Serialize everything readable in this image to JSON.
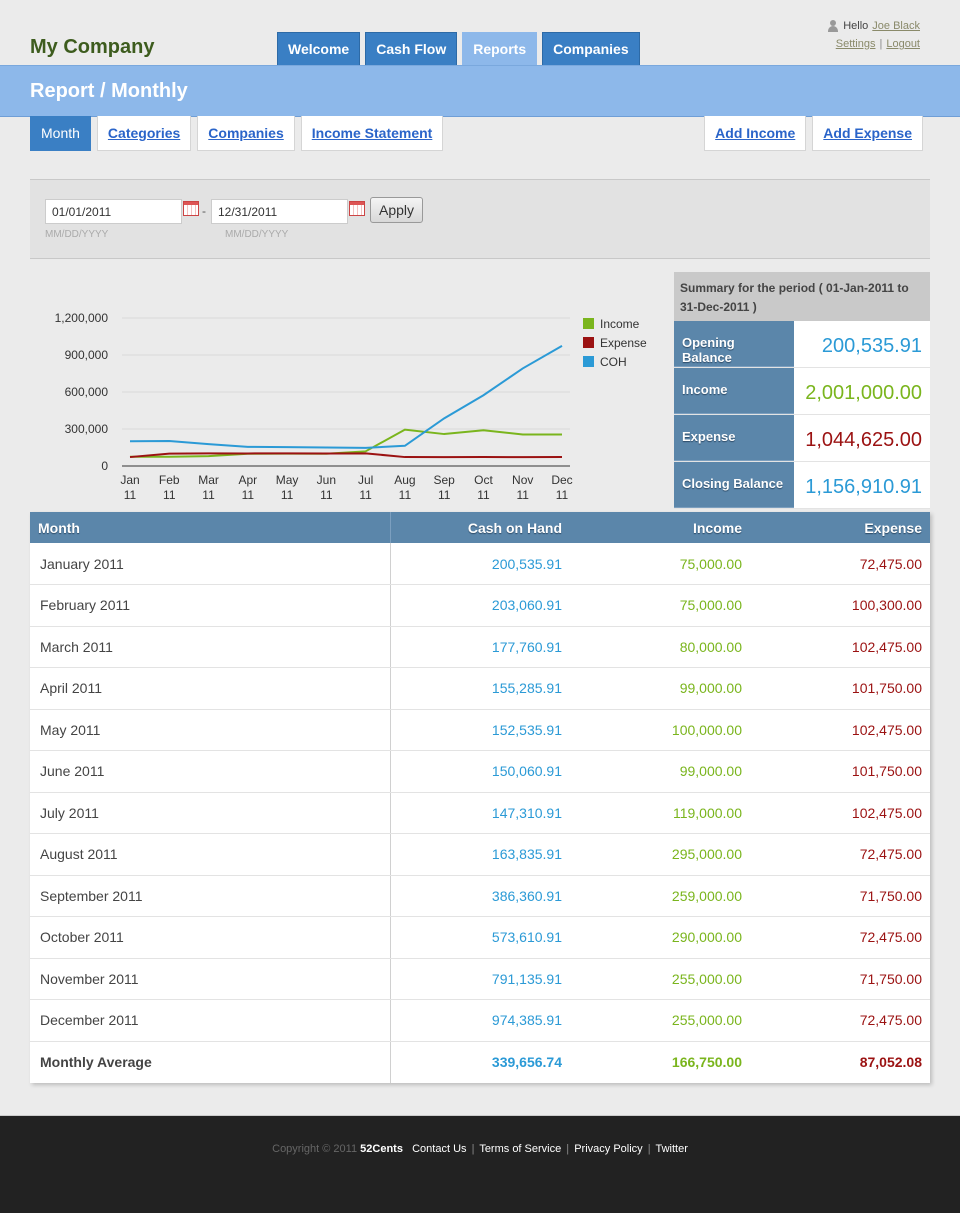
{
  "header": {
    "brand": "My Company",
    "nav": [
      "Welcome",
      "Cash Flow",
      "Reports",
      "Companies"
    ],
    "active_nav": "Reports",
    "greeting": "Hello",
    "user_name": "Joe Black",
    "settings_label": "Settings",
    "logout_label": "Logout",
    "link_separator": "|"
  },
  "page_title": "Report / Monthly",
  "sub_tabs": [
    "Month",
    "Categories",
    "Companies",
    "Income Statement"
  ],
  "active_sub_tab": "Month",
  "actions": [
    "Add Income",
    "Add Expense"
  ],
  "filter": {
    "from_date": "01/01/2011",
    "to_date": "12/31/2011",
    "separator": "-",
    "date_hint": "MM/DD/YYYY",
    "apply_label": "Apply"
  },
  "colors": {
    "coh": "#2b9ad6",
    "income": "#7ab51d",
    "expense": "#9b1212",
    "header_blue": "#5b86aa",
    "nav_blue": "#3a7fc4",
    "title_bar": "#8db8ea"
  },
  "chart_data": {
    "type": "line",
    "categories": [
      "Jan 11",
      "Feb 11",
      "Mar 11",
      "Apr 11",
      "May 11",
      "Jun 11",
      "Jul 11",
      "Aug 11",
      "Sep 11",
      "Oct 11",
      "Nov 11",
      "Dec 11"
    ],
    "series": [
      {
        "name": "Income",
        "values": [
          75000,
          75000,
          80000,
          99000,
          100000,
          99000,
          119000,
          295000,
          259000,
          290000,
          255000,
          255000
        ]
      },
      {
        "name": "Expense",
        "values": [
          72475,
          100300,
          102475,
          101750,
          102475,
          101750,
          102475,
          72475,
          71750,
          72475,
          71750,
          72475
        ]
      },
      {
        "name": "COH",
        "values": [
          200535.91,
          203060.91,
          177760.91,
          155285.91,
          152535.91,
          150060.91,
          147310.91,
          163835.91,
          386360.91,
          573610.91,
          791135.91,
          974385.91
        ]
      }
    ],
    "y_ticks": [
      "0",
      "300,000",
      "600,000",
      "900,000",
      "1,200,000"
    ],
    "ylim": [
      0,
      1200000
    ],
    "grid": true,
    "legend_position": "top-right"
  },
  "summary": {
    "title": "Summary for the period ( 01-Jan-2011 to 31-Dec-2011 )",
    "rows": [
      {
        "label": "Opening Balance",
        "value": "200,535.91"
      },
      {
        "label": "Income",
        "value": "2,001,000.00"
      },
      {
        "label": "Expense",
        "value": "1,044,625.00"
      },
      {
        "label": "Closing Balance",
        "value": "1,156,910.91"
      }
    ]
  },
  "table": {
    "columns": [
      "Month",
      "Cash on Hand",
      "Income",
      "Expense"
    ],
    "rows": [
      {
        "month": "January 2011",
        "coh": "200,535.91",
        "income": "75,000.00",
        "expense": "72,475.00"
      },
      {
        "month": "February 2011",
        "coh": "203,060.91",
        "income": "75,000.00",
        "expense": "100,300.00"
      },
      {
        "month": "March 2011",
        "coh": "177,760.91",
        "income": "80,000.00",
        "expense": "102,475.00"
      },
      {
        "month": "April 2011",
        "coh": "155,285.91",
        "income": "99,000.00",
        "expense": "101,750.00"
      },
      {
        "month": "May 2011",
        "coh": "152,535.91",
        "income": "100,000.00",
        "expense": "102,475.00"
      },
      {
        "month": "June 2011",
        "coh": "150,060.91",
        "income": "99,000.00",
        "expense": "101,750.00"
      },
      {
        "month": "July 2011",
        "coh": "147,310.91",
        "income": "119,000.00",
        "expense": "102,475.00"
      },
      {
        "month": "August 2011",
        "coh": "163,835.91",
        "income": "295,000.00",
        "expense": "72,475.00"
      },
      {
        "month": "September 2011",
        "coh": "386,360.91",
        "income": "259,000.00",
        "expense": "71,750.00"
      },
      {
        "month": "October 2011",
        "coh": "573,610.91",
        "income": "290,000.00",
        "expense": "72,475.00"
      },
      {
        "month": "November 2011",
        "coh": "791,135.91",
        "income": "255,000.00",
        "expense": "71,750.00"
      },
      {
        "month": "December 2011",
        "coh": "974,385.91",
        "income": "255,000.00",
        "expense": "72,475.00"
      }
    ],
    "average": {
      "month": "Monthly Average",
      "coh": "339,656.74",
      "income": "166,750.00",
      "expense": "87,052.08"
    }
  },
  "footer": {
    "copyright": "Copyright © 2011",
    "brand": "52Cents",
    "links": [
      "Contact Us",
      "Terms of Service",
      "Privacy Policy",
      "Twitter"
    ],
    "separator": "|"
  }
}
